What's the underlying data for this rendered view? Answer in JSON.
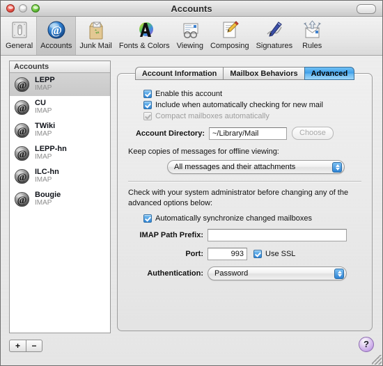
{
  "window": {
    "title": "Accounts",
    "controls": {
      "close": "close-button",
      "minimize": "minimize-button",
      "zoom": "zoom-button",
      "toolbar_toggle": "toolbar-toggle-button"
    }
  },
  "toolbar": {
    "items": [
      {
        "label": "General",
        "icon": "general-icon",
        "selected": false
      },
      {
        "label": "Accounts",
        "icon": "accounts-icon",
        "selected": true
      },
      {
        "label": "Junk Mail",
        "icon": "junk-mail-icon",
        "selected": false
      },
      {
        "label": "Fonts & Colors",
        "icon": "fonts-colors-icon",
        "selected": false
      },
      {
        "label": "Viewing",
        "icon": "viewing-icon",
        "selected": false
      },
      {
        "label": "Composing",
        "icon": "composing-icon",
        "selected": false
      },
      {
        "label": "Signatures",
        "icon": "signatures-icon",
        "selected": false
      },
      {
        "label": "Rules",
        "icon": "rules-icon",
        "selected": false
      }
    ]
  },
  "sidebar": {
    "header": "Accounts",
    "accounts": [
      {
        "name": "LEPP",
        "type": "IMAP",
        "selected": true
      },
      {
        "name": "CU",
        "type": "IMAP",
        "selected": false
      },
      {
        "name": "TWiki",
        "type": "IMAP",
        "selected": false
      },
      {
        "name": "LEPP-hn",
        "type": "IMAP",
        "selected": false
      },
      {
        "name": "ILC-hn",
        "type": "IMAP",
        "selected": false
      },
      {
        "name": "Bougie",
        "type": "IMAP",
        "selected": false
      }
    ],
    "add_label": "+",
    "remove_label": "−"
  },
  "tabs": [
    {
      "label": "Account Information",
      "active": false
    },
    {
      "label": "Mailbox Behaviors",
      "active": false
    },
    {
      "label": "Advanced",
      "active": true
    }
  ],
  "advanced": {
    "enable_account": {
      "label": "Enable this account",
      "checked": true,
      "enabled": true
    },
    "include_auto_check": {
      "label": "Include when automatically checking for new mail",
      "checked": true,
      "enabled": true
    },
    "compact_mailboxes": {
      "label": "Compact mailboxes automatically",
      "checked": true,
      "enabled": false
    },
    "account_directory": {
      "label": "Account Directory:",
      "value": "~/Library/Mail",
      "placeholder": "",
      "choose_label": "Choose"
    },
    "keep_copies": {
      "label": "Keep copies of messages for offline viewing:",
      "selected": "All messages and their attachments"
    },
    "admin_note": "Check with your system administrator before changing any of the advanced options below:",
    "auto_sync": {
      "label": "Automatically synchronize changed mailboxes",
      "checked": true
    },
    "imap_path_prefix": {
      "label": "IMAP Path Prefix:",
      "value": "",
      "placeholder": ""
    },
    "port": {
      "label": "Port:",
      "value": "993"
    },
    "use_ssl": {
      "label": "Use SSL",
      "checked": true
    },
    "authentication": {
      "label": "Authentication:",
      "selected": "Password"
    }
  },
  "help": {
    "label": "?"
  },
  "colors": {
    "accent_blue": "#3f9ee8",
    "checkbox_blue": "#2f85d6",
    "help_purple": "#c9a8e8",
    "selection_grey": "#cfcfcf"
  }
}
